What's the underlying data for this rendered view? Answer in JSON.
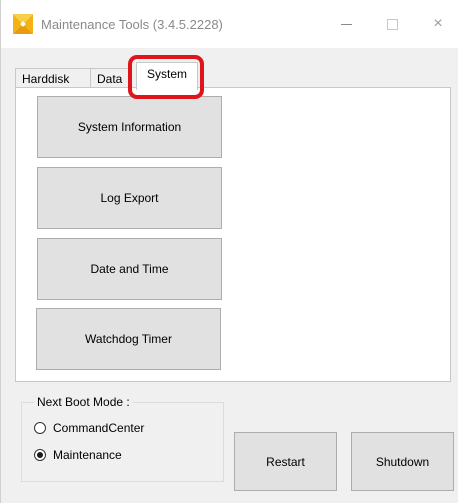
{
  "window": {
    "title": "Maintenance Tools (3.4.5.2228)",
    "icon": "app-logo-icon",
    "controls": {
      "minimize": "minimize-icon",
      "maximize": "maximize-icon",
      "close": "×"
    }
  },
  "tabs": [
    {
      "label": "Harddisk",
      "selected": false
    },
    {
      "label": "Data",
      "selected": false
    },
    {
      "label": "System",
      "selected": true
    }
  ],
  "highlight_color": "#e0141b",
  "system_panel": {
    "buttons": [
      {
        "label": "System Information"
      },
      {
        "label": "Log Export"
      },
      {
        "label": "Date and Time"
      },
      {
        "label": "Watchdog Timer"
      }
    ]
  },
  "boot_mode": {
    "title": "Next Boot Mode :",
    "options": [
      {
        "label": "CommandCenter",
        "checked": false
      },
      {
        "label": "Maintenance",
        "checked": true
      }
    ]
  },
  "actions": {
    "restart_label": "Restart",
    "shutdown_label": "Shutdown"
  }
}
